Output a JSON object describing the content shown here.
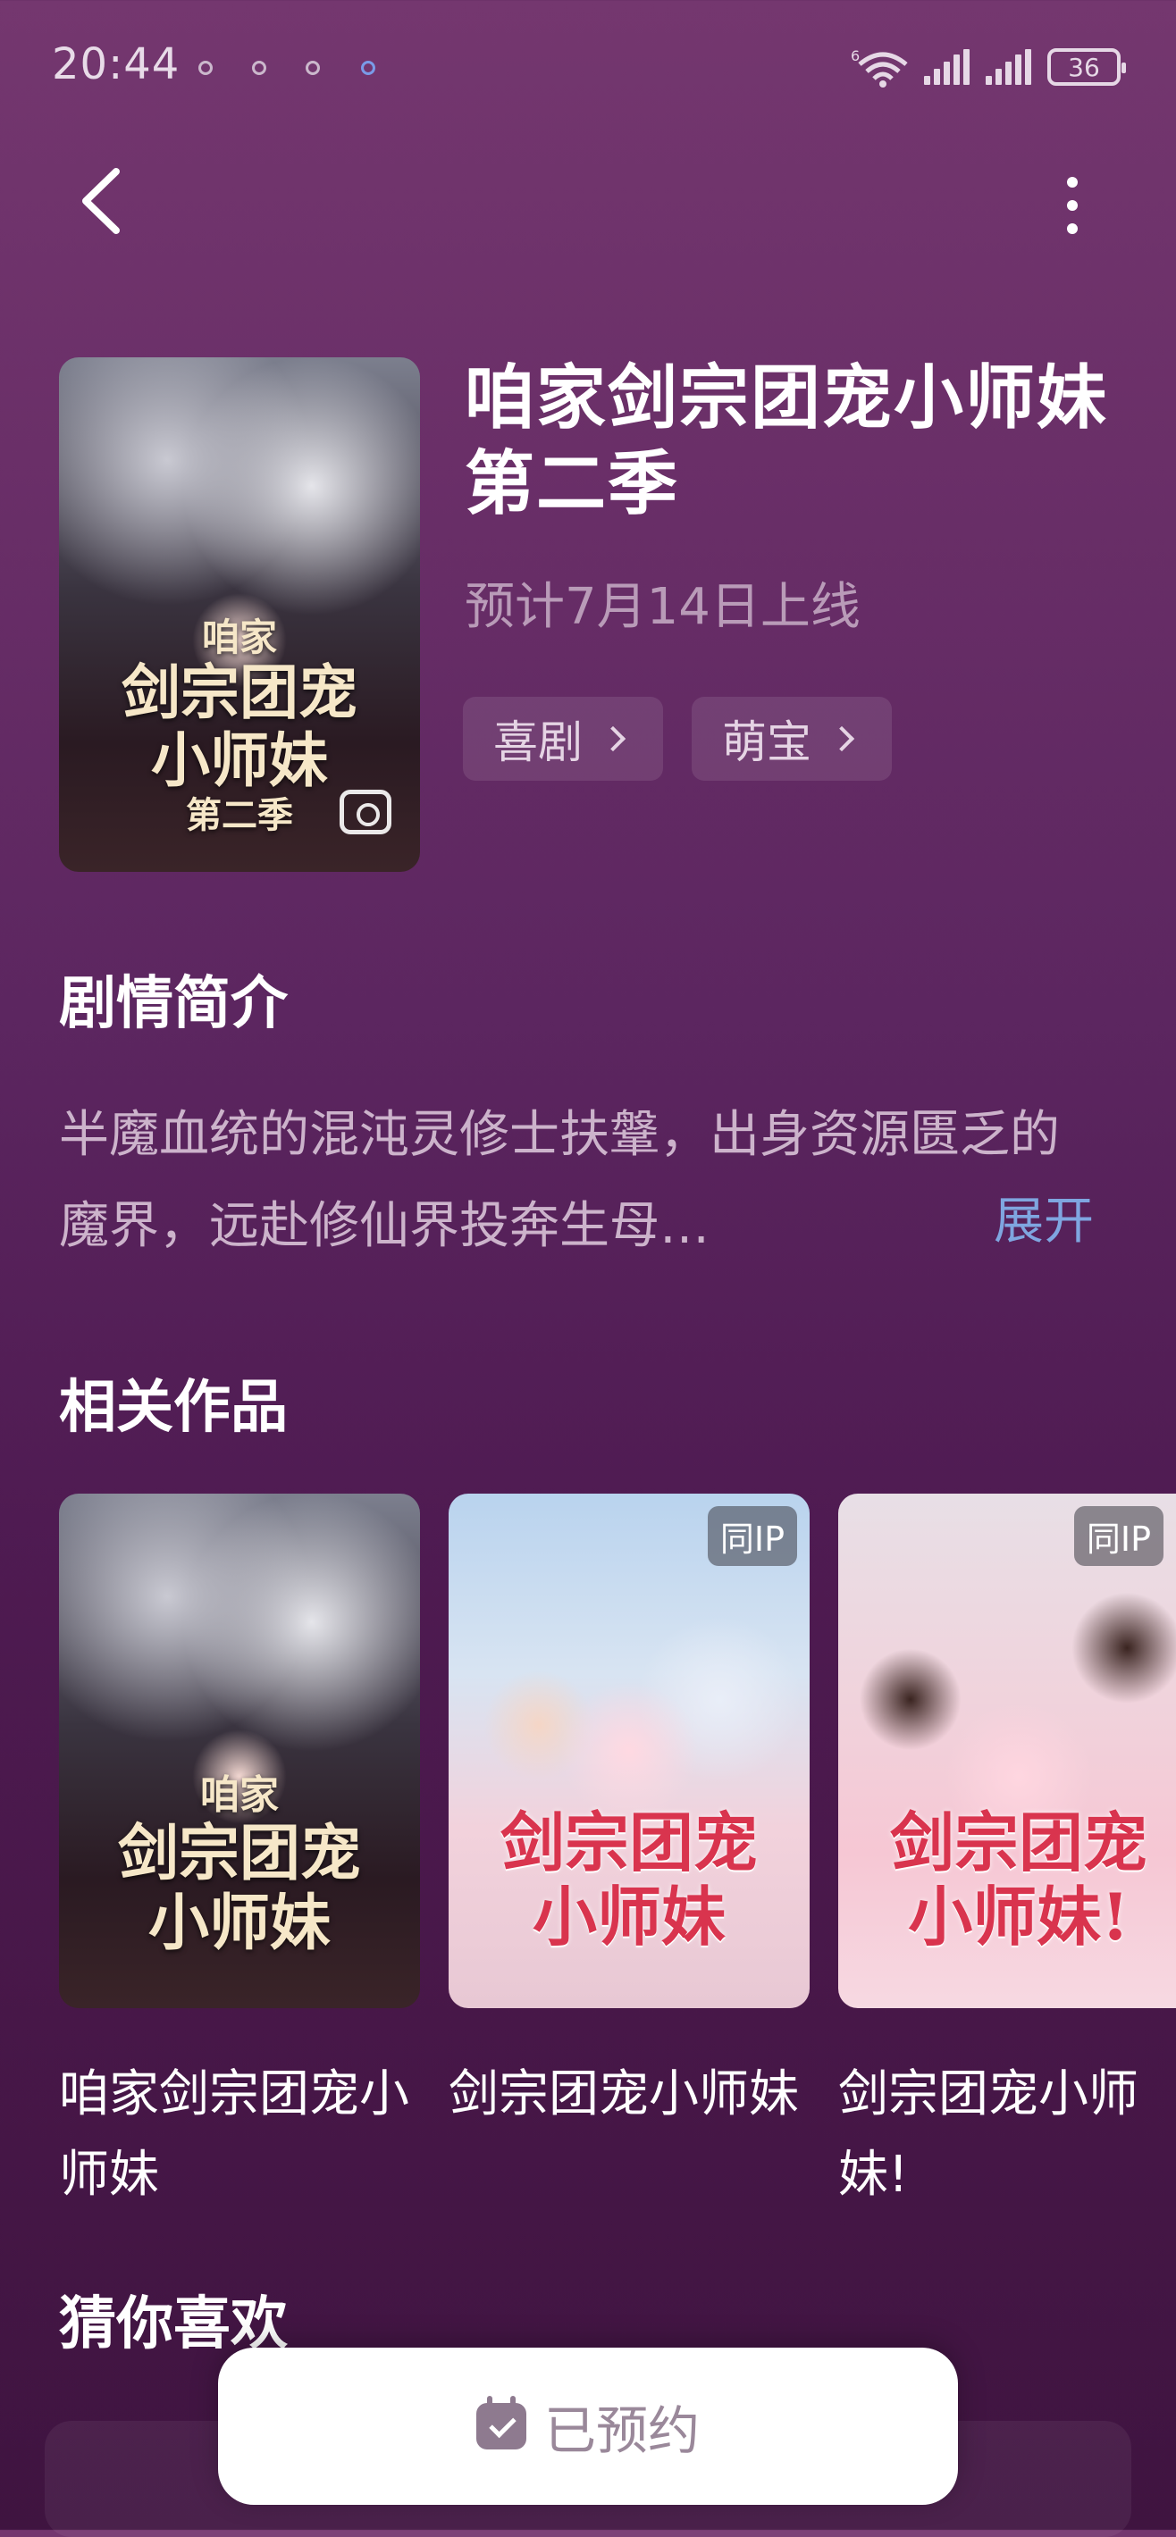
{
  "status_bar": {
    "time": "20:44",
    "battery": "36",
    "network": "6"
  },
  "nav": {
    "back_icon": "chevron-left-icon",
    "more_icon": "more-vertical-icon"
  },
  "show": {
    "title": "咱家剑宗团宠小师妹第二季",
    "release": "预计7月14日上线",
    "cover_text": [
      "咱家",
      "剑宗团宠",
      "小师妹",
      "第二季"
    ],
    "tags": [
      {
        "label": "喜剧"
      },
      {
        "label": "萌宝"
      }
    ]
  },
  "synopsis": {
    "heading": "剧情简介",
    "text": "半魔血统的混沌灵修士扶鞶，出身资源匮乏的魔界，远赴修仙界投奔生母…",
    "expand": "展开"
  },
  "related": {
    "heading": "相关作品",
    "items": [
      {
        "title": "咱家剑宗团宠小师妹",
        "cover_text": [
          "咱家",
          "剑宗团宠",
          "小师妹"
        ],
        "badge": ""
      },
      {
        "title": "剑宗团宠小师妹",
        "cover_text": [
          "剑宗团宠",
          "小师妹"
        ],
        "badge": "同IP"
      },
      {
        "title": "剑宗团宠小师妹!",
        "cover_text": [
          "剑宗团宠",
          "小师妹!"
        ],
        "badge": "同IP"
      }
    ]
  },
  "recommend": {
    "heading": "猜你喜欢"
  },
  "reserve_button": {
    "label": "已预约"
  }
}
